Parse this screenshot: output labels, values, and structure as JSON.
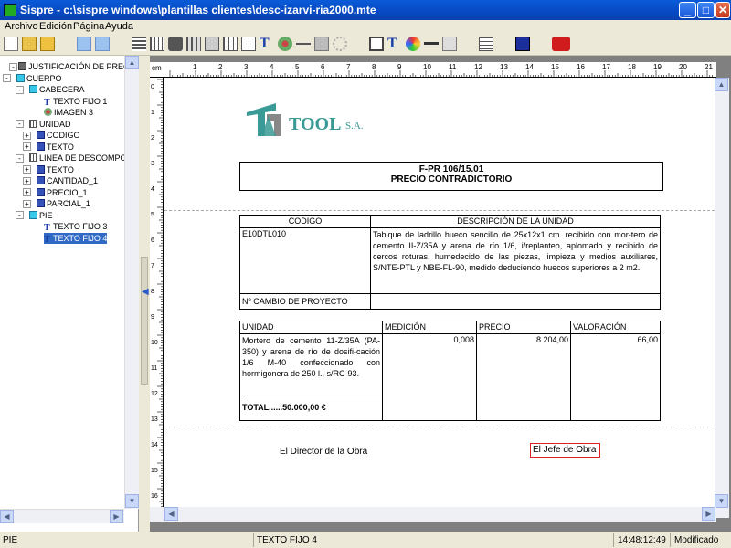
{
  "window": {
    "title": "Sispre - c:\\sispre windows\\plantillas clientes\\desc-izarvi-ria2000.mte",
    "min_label": "_",
    "max_label": "□",
    "close_label": "✕"
  },
  "menu": [
    "Archivo",
    "Edición",
    "Página",
    "Ayuda"
  ],
  "tree": {
    "nodes": [
      {
        "label": "JUSTIFICACIÓN DE PRECIO",
        "icon": "section-icon"
      },
      {
        "label": "CUERPO",
        "icon": "page-icon"
      },
      {
        "label": "CABECERA",
        "icon": "page-icon"
      },
      {
        "label": "TEXTO FIJO 1",
        "icon": "text-t-icon"
      },
      {
        "label": "IMAGEN 3",
        "icon": "image-icon"
      },
      {
        "label": "UNIDAD",
        "icon": "table-icon"
      },
      {
        "label": "CODIGO",
        "icon": "column-icon"
      },
      {
        "label": "TEXTO",
        "icon": "column-icon"
      },
      {
        "label": "LINEA DE DESCOMPOSICION",
        "icon": "table-icon"
      },
      {
        "label": "TEXTO",
        "icon": "column-icon"
      },
      {
        "label": "CANTIDAD_1",
        "icon": "column-icon"
      },
      {
        "label": "PRECIO_1",
        "icon": "column-icon"
      },
      {
        "label": "PARCIAL_1",
        "icon": "column-icon"
      },
      {
        "label": "PIE",
        "icon": "page-icon"
      },
      {
        "label": "TEXTO FIJO 3",
        "icon": "text-t-icon"
      },
      {
        "label": "TEXTO FIJO 4",
        "icon": "text-t-icon",
        "selected": true
      }
    ]
  },
  "ruler": {
    "unit": "cm",
    "h_ticks": [
      "1",
      "2",
      "3",
      "4",
      "5",
      "6",
      "7",
      "8",
      "9",
      "10",
      "11",
      "12",
      "13",
      "14",
      "15",
      "16",
      "17",
      "18",
      "19",
      "20",
      "21"
    ],
    "v_ticks": [
      "0",
      "1",
      "2",
      "3",
      "4",
      "5",
      "6",
      "7",
      "8",
      "9",
      "10",
      "11",
      "12",
      "13",
      "14",
      "15",
      "16"
    ]
  },
  "document": {
    "logo_text": "TOOL",
    "logo_suffix": "S.A.",
    "header_line1": "F-PR 106/15.01",
    "header_line2": "PRECIO CONTRADICTORIO",
    "col_codigo": "CODIGO",
    "col_desc": "DESCRIPCIÓN DE LA UNIDAD",
    "code_value": "E10DTL010",
    "desc_value": "Tabique de ladrillo hueco sencillo de 25x12x1 cm. recibido con mor-tero de cemento II-Z/35A y arena de río 1/6, i/replanteo, aplomado y recibido de cercos roturas, humedecido de las piezas, limpieza y medios auxiliares, S/NTE-PTL y NBE-FL-90, medido deduciendo huecos superiores a 2 m2.",
    "cambio_label": "Nº CAMBIO DE PROYECTO",
    "col_unidad": "UNIDAD",
    "col_medicion": "MEDICIÓN",
    "col_precio": "PRECIO",
    "col_valoracion": "VALORACIÓN",
    "unidad_value": "Mortero de cemento 11-Z/35A (PA-350) y arena de río de dosifi-cación 1/6 M-40 confeccionado con hormigonera de 250 l., s/RC-93.",
    "medicion_value": "0,008",
    "precio_value": "8.204,00",
    "valoracion_value": "66,00",
    "total_label": "TOTAL......50.000,00 €",
    "director_label": "El Director de la Obra",
    "jefe_label": "El Jefe de Obra"
  },
  "status": {
    "section": "PIE",
    "element": "TEXTO FIJO 4",
    "time": "14:48:12:49",
    "state": "Modificado"
  },
  "colors": {
    "logo_teal": "#3a9a96",
    "selection": "#316ac5",
    "title_blue": "#0a5bd8"
  }
}
